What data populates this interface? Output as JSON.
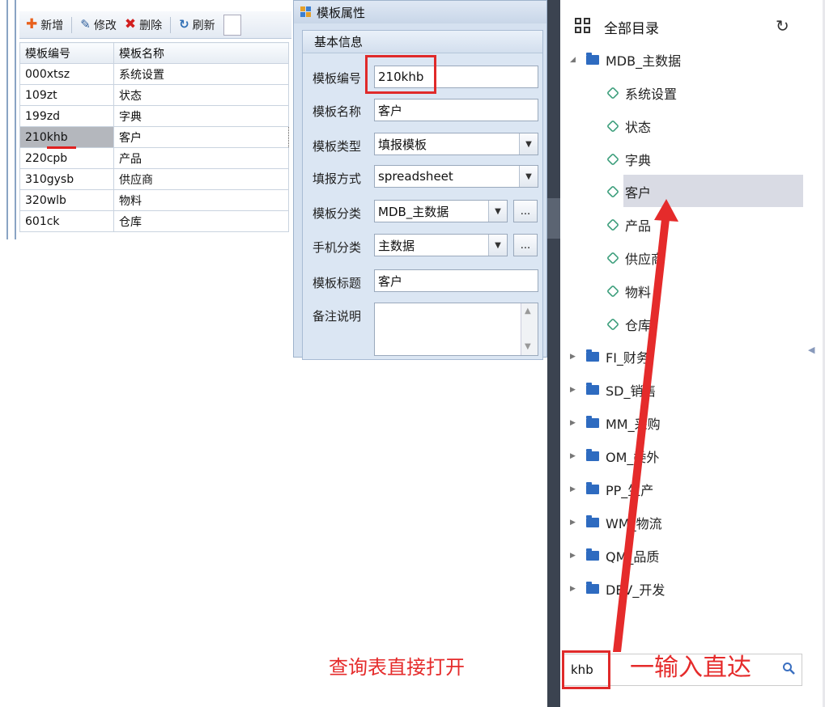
{
  "toolbar": {
    "add_label": "新增",
    "edit_label": "修改",
    "delete_label": "删除",
    "refresh_label": "刷新"
  },
  "grid": {
    "columns": [
      "模板编号",
      "模板名称"
    ],
    "rows": [
      {
        "code": "000xtsz",
        "name": "系统设置"
      },
      {
        "code": "109zt",
        "name": "状态"
      },
      {
        "code": "199zd",
        "name": "字典"
      },
      {
        "code": "210khb",
        "name": "客户"
      },
      {
        "code": "220cpb",
        "name": "产品"
      },
      {
        "code": "310gysb",
        "name": "供应商"
      },
      {
        "code": "320wlb",
        "name": "物料"
      },
      {
        "code": "601ck",
        "name": "仓库"
      }
    ],
    "selected_code": "210khb"
  },
  "properties": {
    "window_title": "模板属性",
    "group_title": "基本信息",
    "fields": {
      "code_label": "模板编号",
      "code_value": "210khb",
      "name_label": "模板名称",
      "name_value": "客户",
      "type_label": "模板类型",
      "type_value": "填报模板",
      "mode_label": "填报方式",
      "mode_value": "spreadsheet",
      "category_label": "模板分类",
      "category_value": "MDB_主数据",
      "mobile_label": "手机分类",
      "mobile_value": "主数据",
      "title_label": "模板标题",
      "title_value": "客户",
      "remark_label": "备注说明"
    },
    "ellipsis": "..."
  },
  "tree": {
    "header": "全部目录",
    "root": "MDB_主数据",
    "children": [
      "系统设置",
      "状态",
      "字典",
      "客户",
      "产品",
      "供应商",
      "物料",
      "仓库"
    ],
    "selected": "客户",
    "folders": [
      "FI_财务",
      "SD_销售",
      "MM_采购",
      "OM_委外",
      "PP_生产",
      "WM_物流",
      "QM_品质",
      "DEV_开发"
    ]
  },
  "search": {
    "value": "khb"
  },
  "annotations": {
    "left_note": "查询表直接打开",
    "right_note": "一输入直达"
  },
  "colors": {
    "annotation_red": "#e52b2b",
    "folder_blue": "#2e6bc0",
    "cube_green": "#3a9d7a"
  }
}
